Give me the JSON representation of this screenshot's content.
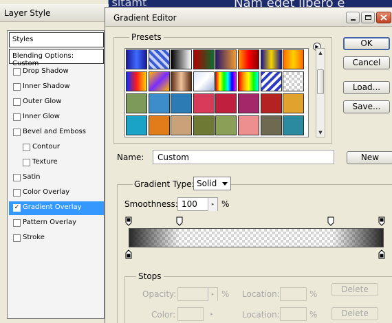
{
  "background": {
    "text_right": "Nam eget libero e",
    "text_left": "m dolor sitamt"
  },
  "layer_style": {
    "title": "Layer Style",
    "styles_header": "Styles",
    "blending_options": "Blending Options: Custom",
    "items": [
      {
        "label": "Drop Shadow",
        "checked": false
      },
      {
        "label": "Inner Shadow",
        "checked": false
      },
      {
        "label": "Outer Glow",
        "checked": false
      },
      {
        "label": "Inner Glow",
        "checked": false
      },
      {
        "label": "Bevel and Emboss",
        "checked": false
      },
      {
        "label": "Contour",
        "checked": false
      },
      {
        "label": "Texture",
        "checked": false
      },
      {
        "label": "Satin",
        "checked": false
      },
      {
        "label": "Color Overlay",
        "checked": false
      },
      {
        "label": "Gradient Overlay",
        "checked": true,
        "selected": true
      },
      {
        "label": "Pattern Overlay",
        "checked": false
      },
      {
        "label": "Stroke",
        "checked": false
      }
    ],
    "check_mark": "✓"
  },
  "gradient_editor": {
    "title": "Gradient Editor",
    "presets_legend": "Presets",
    "presets_menu_icon": "▶",
    "buttons": {
      "ok": "OK",
      "cancel": "Cancel",
      "load": "Load...",
      "save": "Save...",
      "new": "New"
    },
    "name_label": "Name:",
    "name_value": "Custom",
    "gradient_type_label": "Gradient Type:",
    "gradient_type_value": "Solid",
    "smoothness_label": "Smoothness:",
    "smoothness_value": "100",
    "smoothness_unit": "%",
    "stops": {
      "legend": "Stops",
      "opacity_label": "Opacity:",
      "opacity_unit": "%",
      "color_label": "Color:",
      "location_label": "Location:",
      "location_unit": "%",
      "delete_label": "Delete"
    },
    "scroll_up": "▲",
    "scroll_down": "▼",
    "stepper_arrow": "▸"
  }
}
